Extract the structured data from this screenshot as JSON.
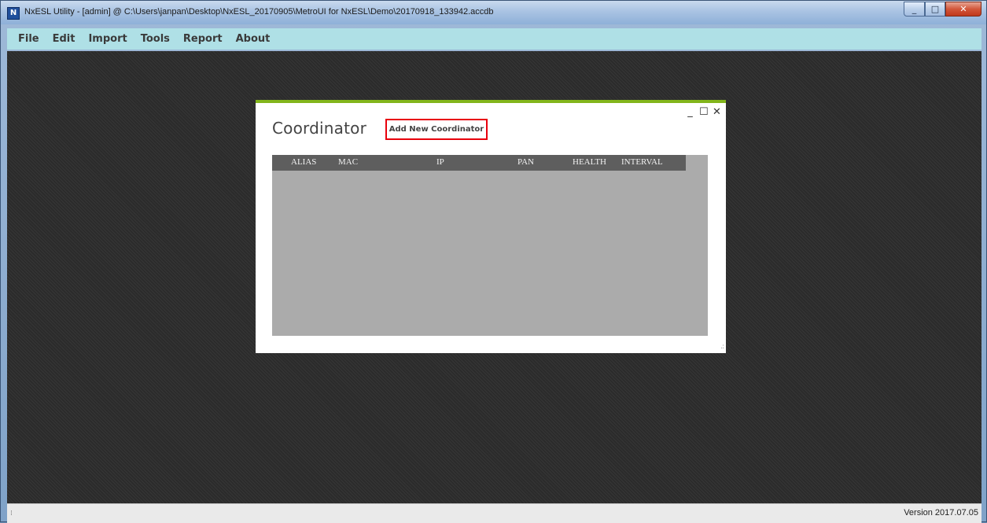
{
  "window": {
    "title": "NxESL Utility - [admin] @ C:\\Users\\janpan\\Desktop\\NxESL_20170905\\MetroUI for NxESL\\Demo\\20170918_133942.accdb",
    "icon": "app-icon"
  },
  "menu": {
    "items": [
      "File",
      "Edit",
      "Import",
      "Tools",
      "Report",
      "About"
    ]
  },
  "dialog": {
    "title": "Coordinator",
    "add_button": "Add New Coordinator",
    "controls": {
      "minimize": "_",
      "maximize": "☐",
      "close": "✕"
    },
    "accent_color": "#82b51b",
    "highlight_color": "#e8000c",
    "columns": [
      "ALIAS",
      "MAC",
      "IP",
      "PAN",
      "HEALTH",
      "INTERVAL"
    ]
  },
  "status": {
    "version": "Version 2017.07.05"
  }
}
